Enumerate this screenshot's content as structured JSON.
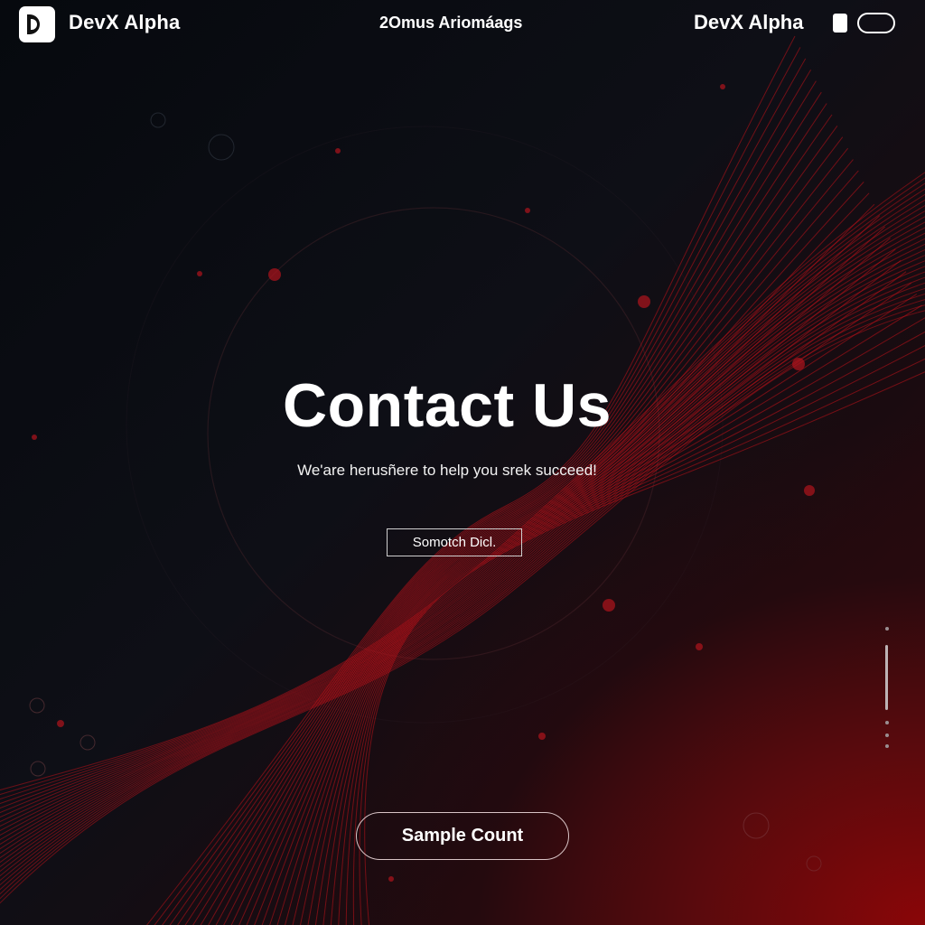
{
  "header": {
    "brand_left": "DevX Alpha",
    "center_link": "2Omus Ariomáags",
    "brand_right": "DevX Alpha"
  },
  "hero": {
    "title": "Contact Us",
    "subtitle": "We'are herusñere to help you srek succeed!",
    "search_button": "Somotch Dicl.",
    "cta_button": "Sample Count"
  },
  "colors": {
    "accent": "#c1121a",
    "background_dark": "#0b0d12",
    "background_red": "#8a0608"
  }
}
